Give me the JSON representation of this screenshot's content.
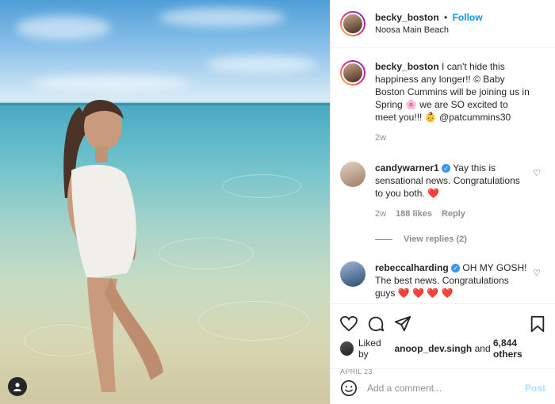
{
  "post": {
    "username": "becky_boston",
    "separator": "•",
    "follow_label": "Follow",
    "location": "Noosa Main Beach",
    "more_icon": "more-dots-icon"
  },
  "caption": {
    "username": "becky_boston",
    "text": "I can't hide this happiness any longer!! © Baby Boston Cummins will be joining us in Spring 🌸 we are SO excited to meet you!!! 👶 @patcummins30",
    "age": "2w"
  },
  "comments": [
    {
      "username": "candywarner1",
      "text": "Yay this is sensational news. Congratulations to you both.",
      "emoji": "❤️",
      "age": "2w",
      "likes": "188 likes",
      "reply_label": "Reply",
      "view_replies": "View replies (2)"
    },
    {
      "username": "rebeccalharding",
      "text": "OH MY GOSH! The best news. Congratulations guys",
      "emoji": "❤️ ❤️ ❤️ ❤️"
    }
  ],
  "likes_line": {
    "prefix": "Liked by",
    "user": "anoop_dev.singh",
    "suffix": "and",
    "count": "6,844 others"
  },
  "date": "APRIL 23",
  "add_comment": {
    "placeholder": "Add a comment...",
    "post_label": "Post"
  },
  "colors": {
    "accent": "#0095f6",
    "muted": "#8e8e8e",
    "verified": "#3897f0",
    "heart": "#ed1c24"
  }
}
